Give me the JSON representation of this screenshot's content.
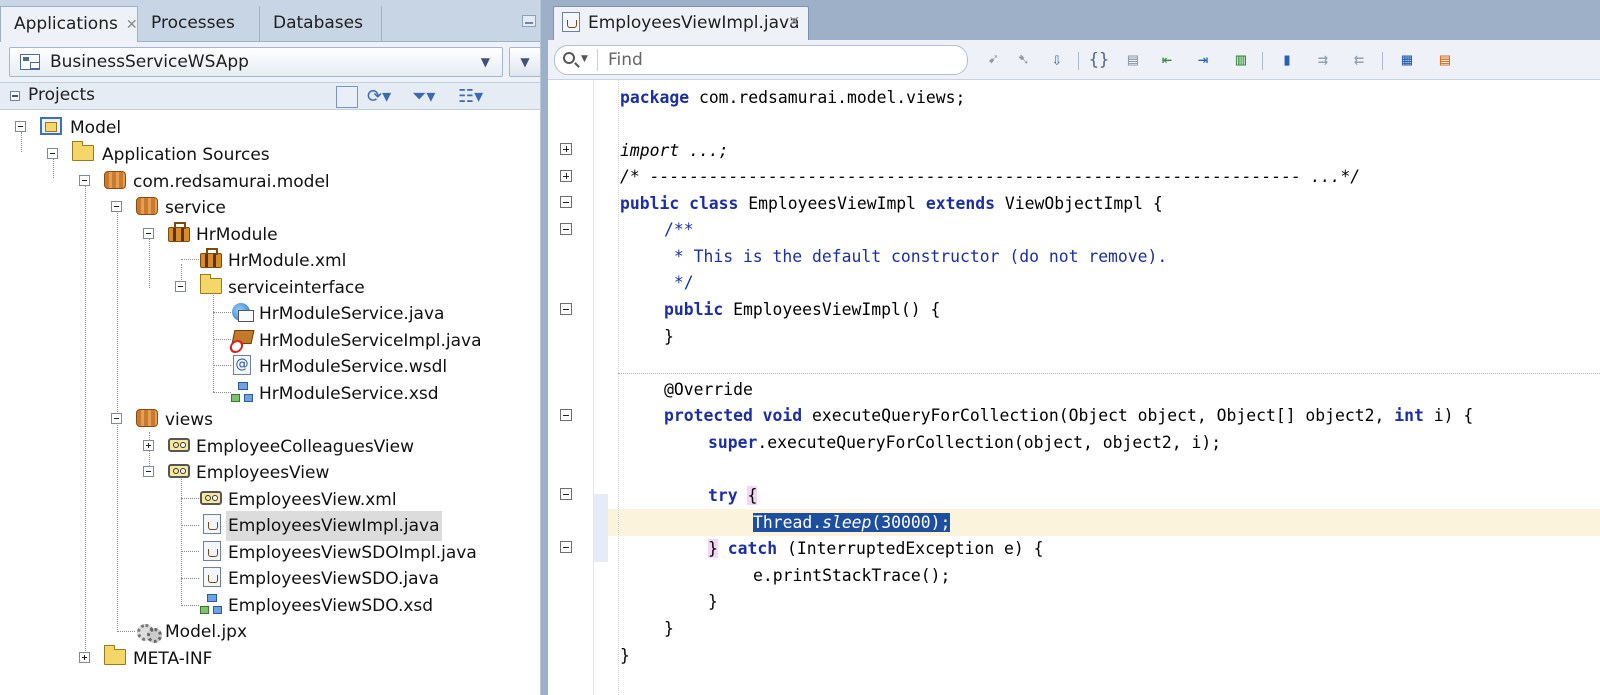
{
  "left_panel": {
    "tabs": [
      "Applications",
      "Processes",
      "Databases"
    ],
    "app_selector": "BusinessServiceWSApp",
    "projects_title": "Projects",
    "tree": [
      "Model",
      "Application Sources",
      "com.redsamurai.model",
      "service",
      "HrModule",
      "HrModule.xml",
      "serviceinterface",
      "HrModuleService.java",
      "HrModuleServiceImpl.java",
      "HrModuleService.wsdl",
      "HrModuleService.xsd",
      "views",
      "EmployeeColleaguesView",
      "EmployeesView",
      "EmployeesView.xml",
      "EmployeesViewImpl.java",
      "EmployeesViewSDOImpl.java",
      "EmployeesViewSDO.java",
      "EmployeesViewSDO.xsd",
      "Model.jpx",
      "META-INF"
    ],
    "selected": "EmployeesViewImpl.java"
  },
  "editor": {
    "tab_title": "EmployeesViewImpl.java",
    "find_placeholder": "Find",
    "code": {
      "l1_kw": "package",
      "l1_rest": " com.redsamurai.model.views;",
      "l3": "import ...;",
      "l4": "/* ------------------------------------------------------------------ ...*/",
      "l5_kw1": "public class",
      "l5_mid": " EmployeesViewImpl ",
      "l5_kw2": "extends",
      "l5_rest": " ViewObjectImpl {",
      "l6": "/**",
      "l7": " * This is the default constructor (do not remove).",
      "l8": " */",
      "l9_kw": "public",
      "l9_rest": " EmployeesViewImpl() {",
      "l10": "}",
      "l12": "@Override",
      "l13_kw": "protected void",
      "l13_a": " executeQueryForCollection(Object object, Object[] object2, ",
      "l13_kw2": "int",
      "l13_b": " i) {",
      "l14_kw": "super",
      "l14_rest": ".executeQueryForCollection(object, object2, i);",
      "l16_kw": "try",
      "l16_brace": "{",
      "l17_a": "Thread.",
      "l17_it": "sleep",
      "l17_b": "(30000);",
      "l18_brace": "}",
      "l18_kw": "catch",
      "l18_rest": " (InterruptedException e) {",
      "l19": "e.printStackTrace();",
      "l20": "}",
      "l21": "}",
      "l22": "}"
    }
  }
}
